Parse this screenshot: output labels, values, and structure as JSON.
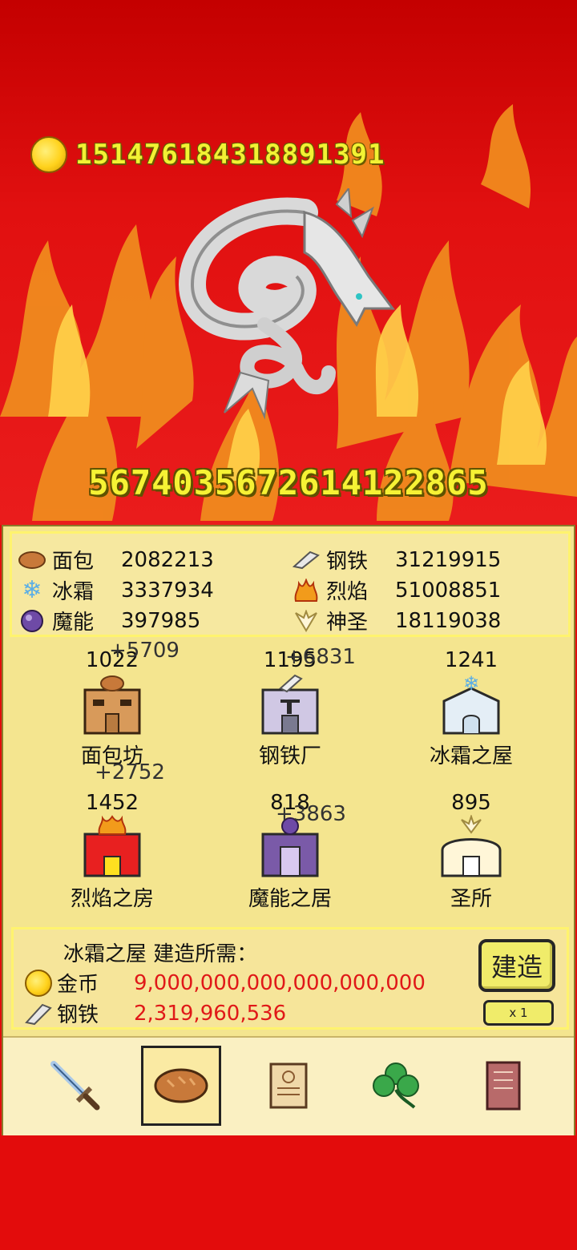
{
  "gold": "151476184318891391",
  "boss_hp": "567403567261412286­5",
  "resources": [
    {
      "name": "面包",
      "value": "2082213",
      "icon": "bread-icon"
    },
    {
      "name": "冰霜",
      "value": "3337934",
      "icon": "snowflake-icon"
    },
    {
      "name": "魔能",
      "value": "397985",
      "icon": "magic-orb-icon"
    },
    {
      "name": "钢铁",
      "value": "31219915",
      "icon": "steel-bar-icon"
    },
    {
      "name": "烈焰",
      "value": "51008851",
      "icon": "flame-icon"
    },
    {
      "name": "神圣",
      "value": "18119038",
      "icon": "holy-wings-icon"
    }
  ],
  "buildings": [
    {
      "name": "面包坊",
      "count": "1022",
      "icon": "bakery-icon"
    },
    {
      "name": "钢铁厂",
      "count": "1195",
      "icon": "steel-mill-icon"
    },
    {
      "name": "冰霜之屋",
      "count": "1241",
      "icon": "frost-house-icon"
    },
    {
      "name": "烈焰之房",
      "count": "1452",
      "icon": "flame-house-icon"
    },
    {
      "name": "魔能之居",
      "count": "818",
      "icon": "magic-house-icon"
    },
    {
      "name": "圣所",
      "count": "895",
      "icon": "sanctuary-icon"
    }
  ],
  "floating": [
    {
      "text": "+5709"
    },
    {
      "text": "+6831"
    },
    {
      "text": "+2752"
    },
    {
      "text": "+3863"
    }
  ],
  "requirement": {
    "title": "冰霜之屋 建造所需：",
    "lines": [
      {
        "label": "金币",
        "amount": "9,000,000,000,000,000,000",
        "icon": "coin-icon"
      },
      {
        "label": "钢铁",
        "amount": "2,319,960,536",
        "icon": "steel-bar-icon"
      }
    ],
    "build_label": "建造",
    "multiplier_label": "x 1"
  },
  "tabs": [
    {
      "icon": "sword-icon",
      "active": false
    },
    {
      "icon": "bread-icon",
      "active": true
    },
    {
      "icon": "scroll-icon",
      "active": false
    },
    {
      "icon": "clover-icon",
      "active": false
    },
    {
      "icon": "book-icon",
      "active": false
    }
  ],
  "colors": {
    "background": "#e30c0c",
    "panel": "#f4e58f",
    "accent_yellow": "#f2f233",
    "cost_red": "#e01818"
  }
}
